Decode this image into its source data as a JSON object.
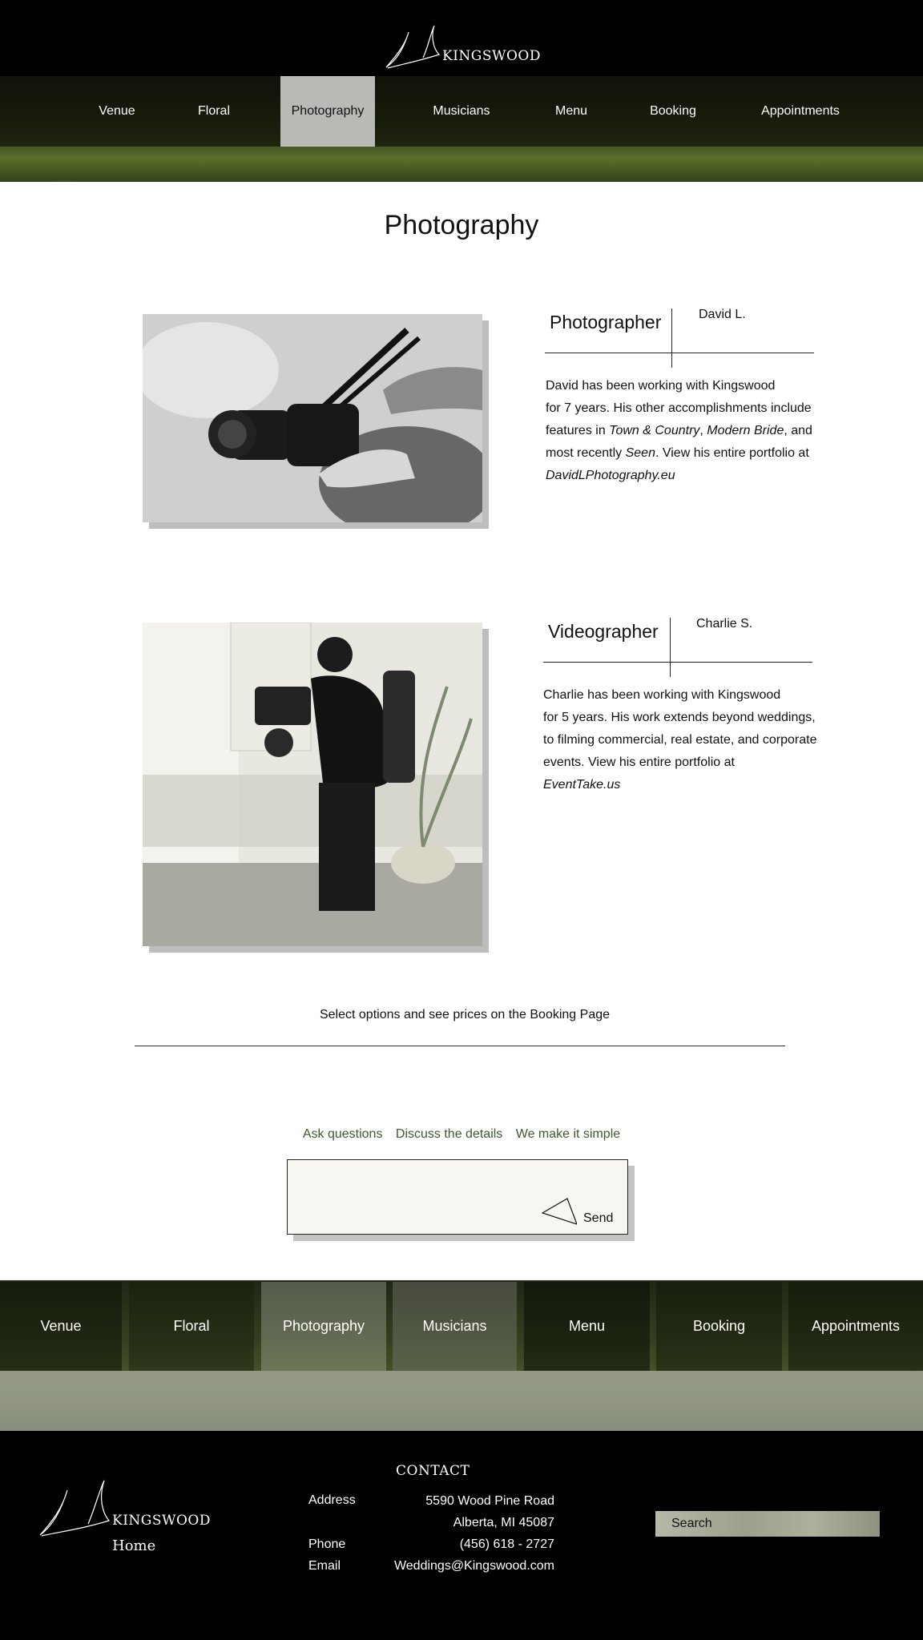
{
  "header": {
    "brand": "KINGSWOOD",
    "nav": [
      "Venue",
      "Floral",
      "Photography",
      "Musicians",
      "Menu",
      "Booking",
      "Appointments"
    ],
    "active_nav": "Photography"
  },
  "main": {
    "title": "Photography",
    "sections": [
      {
        "role": "Photographer",
        "name": "David L.",
        "bio_lines": [
          "David has been working with Kingswood",
          "for 7 years. His other accomplishments include",
          "features in ",
          "Town & Country",
          ", ",
          "Modern Bride",
          ", and",
          "most recently ",
          "Seen",
          ". View his entire portfolio at",
          "DavidLPhotography.eu"
        ]
      },
      {
        "role": "Videographer",
        "name": "Charlie S.",
        "bio_lines": [
          "Charlie has been working with Kingswood",
          "for 5 years. His work extends beyond weddings,",
          "to filming commercial, real estate, and corporate",
          "events. View his entire portfolio at",
          "EventTake.us"
        ]
      }
    ],
    "booking_note": "Select options and see prices on the Booking Page"
  },
  "contact_form": {
    "links": [
      "Ask questions",
      "Discuss the details",
      "We make it simple"
    ],
    "message_value": "",
    "send_label": "Send"
  },
  "footer_nav": [
    "Venue",
    "Floral",
    "Photography",
    "Musicians",
    "Menu",
    "Booking",
    "Appointments"
  ],
  "footer": {
    "brand": "KINGSWOOD",
    "home": "Home",
    "contact_heading": "CONTACT",
    "address_label": "Address",
    "address_line1": "5590 Wood Pine Road",
    "address_line2": "Alberta, MI 45087",
    "phone_label": "Phone",
    "phone": "(456) 618 - 2727",
    "email_label": "Email",
    "email": "Weddings@Kingswood.com",
    "search_placeholder": "Search"
  },
  "colors": {
    "header_bg": "#000000",
    "active_nav_bg": "#b9b9b6",
    "link_green": "#3e5a2c",
    "message_bg": "#f7f6f2"
  }
}
